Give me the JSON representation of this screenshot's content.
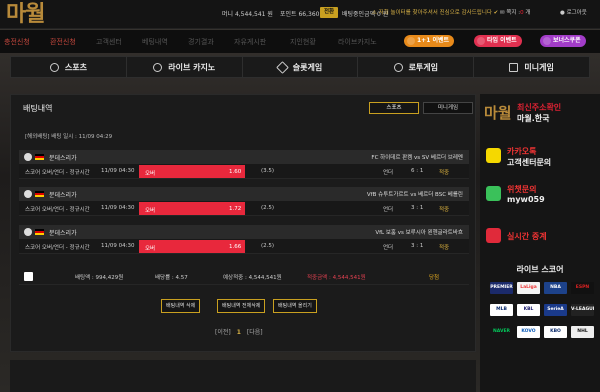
{
  "logo": "마월",
  "topbar": {
    "money": "머니 4,544,541 원",
    "point": "포인트 66,360 P",
    "convert_label": "전환",
    "bet_amount": "배팅중인금액 0 원",
    "notice": "⚠ 저희 놀이터를 찾아주셔서 진심으로 감사드립니다 ✔",
    "message_label": "쪽지 :",
    "message_count": "0",
    "message_suffix": " 개",
    "logout_label": "로그아웃"
  },
  "nav": {
    "items": [
      "충전신청",
      "환전신청",
      "고객센터",
      "베팅내역",
      "경기결과",
      "자유게시판",
      "지인현황",
      "라이브카지노"
    ],
    "pills": [
      {
        "label": "1+1 이벤트",
        "color": "#e88a1a"
      },
      {
        "label": "타임 이벤트",
        "color": "#e03050"
      },
      {
        "label": "보너스쿠폰",
        "color": "#a23cc8"
      }
    ]
  },
  "categories": [
    {
      "label": "스포츠",
      "icon": "soccer-ball-icon"
    },
    {
      "label": "라이브 카지노",
      "icon": "casino-chip-icon"
    },
    {
      "label": "슬롯게임",
      "icon": "diamond-icon"
    },
    {
      "label": "로투게임",
      "icon": "globe-icon"
    },
    {
      "label": "미니게임",
      "icon": "screen-icon"
    }
  ],
  "panel": {
    "title": "배팅내역",
    "tab_sports": "스포츠",
    "tab_mini": "미니게임",
    "bet_info": "[해외배팅] 배팅 일시 : 11/09 04:29"
  },
  "games": [
    {
      "league": "분데스리가",
      "match": "FC 하이데르 판켐 vs SV 베르더 브레멘",
      "bet_type": "스코어 오버/언더 - 정규시간",
      "time": "11/09 04:30",
      "pick": "오버",
      "odds": "1.60",
      "line": "(3.5)",
      "market": "언더",
      "score": "6 : 1",
      "result": "적중"
    },
    {
      "league": "분데스리가",
      "match": "VfB 슈투트가르트 vs 베르더 BSC 베를린",
      "bet_type": "스코어 오버/언더 - 정규시간",
      "time": "11/09 04:30",
      "pick": "오버",
      "odds": "1.72",
      "line": "(2.5)",
      "market": "언더",
      "score": "3 : 1",
      "result": "적중"
    },
    {
      "league": "분데스리가",
      "match": "VfL 보훔 vs 보루시아 묀헨글라트바흐",
      "bet_type": "스코어 오버/언더 - 정규시간",
      "time": "11/09 04:30",
      "pick": "오버",
      "odds": "1.66",
      "line": "(2.5)",
      "market": "언더",
      "score": "3 : 1",
      "result": "적중"
    }
  ],
  "totals": {
    "bet_amount": "배팅액 : 994,429원",
    "odds": "배당률 : 4.57",
    "expected": "예상적중 : 4,544,541원",
    "win_amount": "적중금액 : 4,544,541원",
    "status": "당첨"
  },
  "actions": [
    "배팅내역 삭제",
    "배팅내역 전체삭제",
    "배팅내역 올리기"
  ],
  "pager": {
    "prev": "[이전]",
    "current": "1",
    "next": "[다음]"
  },
  "sidebar": {
    "brand_logo": "마월",
    "brand_line1": "최신주소확인",
    "brand_line2": "마월.한국",
    "kakao_line1": "카카오톡",
    "kakao_line2": "고객센터문의",
    "wechat_line1": "위챗문의",
    "wechat_line2": "myw059",
    "live_label": "실시간 중계",
    "live_score": "라이브 스코어",
    "leagues": [
      "PREMIER",
      "LaLiga",
      "NBA",
      "ESPN",
      "MLB",
      "KBL",
      "SerieA",
      "V-LEAGUE",
      "NAVER",
      "KOVO",
      "KBO",
      "NHL"
    ]
  }
}
